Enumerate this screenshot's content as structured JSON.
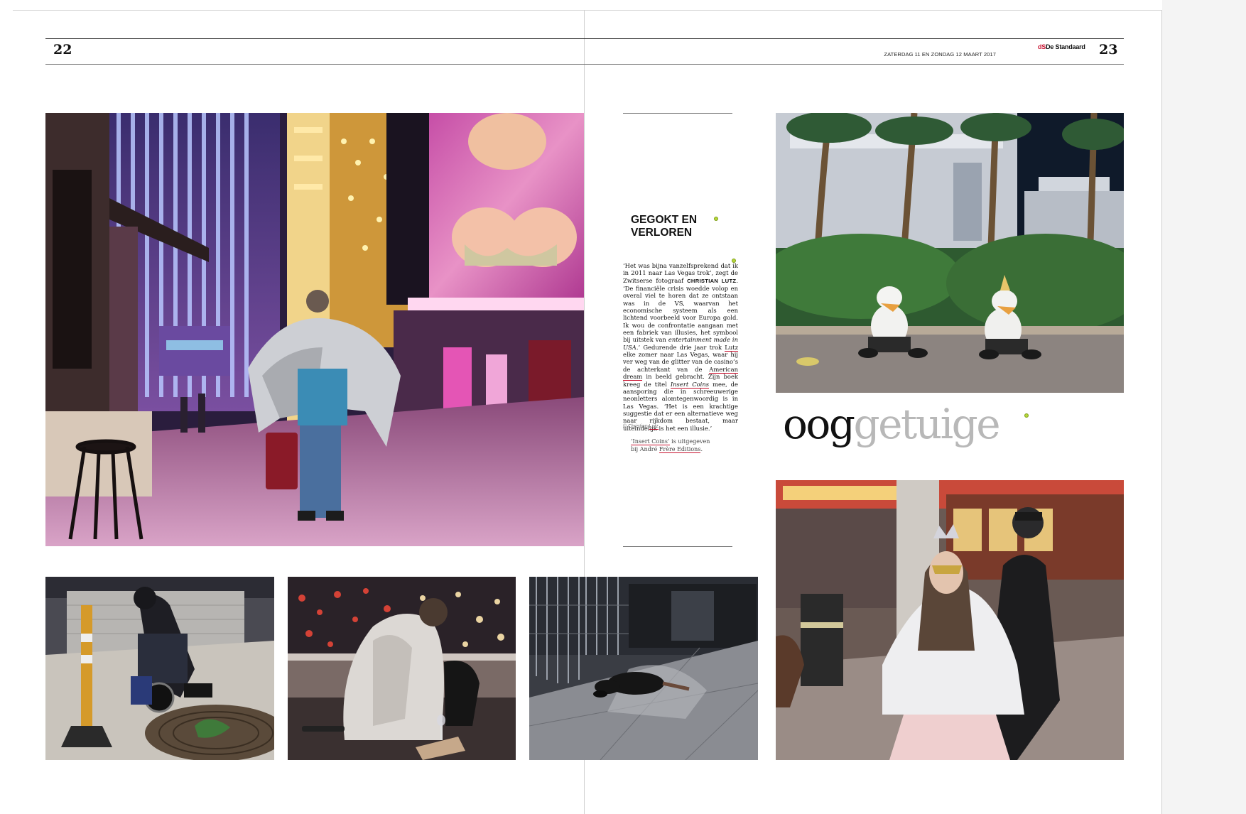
{
  "page_left": {
    "number": "22"
  },
  "page_right": {
    "number": "23",
    "masthead": {
      "mark": "dS",
      "name": "De Standaard"
    },
    "dateline": "ZATERDAG 11 EN ZONDAG 12 MAART 2017"
  },
  "article": {
    "headline_line1": "GEGOKT EN",
    "headline_line2": "VERLOREN",
    "body": {
      "s1": "‘Het was bijna vanzelfsprekend dat ik in 2011 naar Las Vegas trok’, zegt de Zwitserse fotograaf ",
      "photographer": "CHRISTIAN LUTZ",
      "s2": ". ‘De financiële crisis woedde volop en overal viel te horen dat ze ontstaan was in de VS, waarvan het economische systeem als een lichtend voorbeeld voor Europa gold. Ik wou de confrontatie aangaan met een fabriek van illusies, het symbool bij uitstek van ",
      "em1": "entertainment made in USA",
      "s3": ".’ Gedurende drie jaar trok ",
      "lutz": "Lutz",
      "s4": " elke zomer naar Las Vegas, waar hij ver weg van de glitter van de casino’s de achterkant van de ",
      "dream": "American dream",
      "s5": " in beeld gebracht. Zijn boek kreeg de titel ",
      "book": "Insert Coins",
      "s6": " mee, de aansporing die in schreeuwerige neonletters alomtegenwoordig is in Las Vegas. ‘Het is een krachtige suggestie dat er een alternatieve weg naar rijkdom bestaat, maar uiteindelijk is het een illusie.’"
    },
    "credit": {
      "prefix": "© Christian ",
      "name": "Lutz"
    },
    "publication_note": {
      "book": "‘Insert Coins’",
      "mid": " is uitgegeven",
      "by": "bij André ",
      "publisher": "Frère Editions",
      "end": "."
    }
  },
  "rubric": {
    "part1": "oog",
    "part2": "getuige"
  },
  "colors": {
    "accent_red": "#c8102e",
    "rubric_grey": "#b8b8b8",
    "ink": "#111111"
  },
  "photos": [
    {
      "id": "main-fremont-street",
      "subject": "man wrapped in foil blanket with suitcase under neon casino screen"
    },
    {
      "id": "ducks-costumes",
      "subject": "two people in duck costumes sitting by palm trees"
    },
    {
      "id": "wheelchair",
      "subject": "person in wheelchair beside traffic cone"
    },
    {
      "id": "blanket-bridge",
      "subject": "person wrapped in white blanket with wine glass above traffic"
    },
    {
      "id": "lying-pavement",
      "subject": "person lying on sidewalk by shuttered storefronts"
    },
    {
      "id": "masked-woman",
      "subject": "woman with tiara and gold mask in white cape"
    }
  ]
}
